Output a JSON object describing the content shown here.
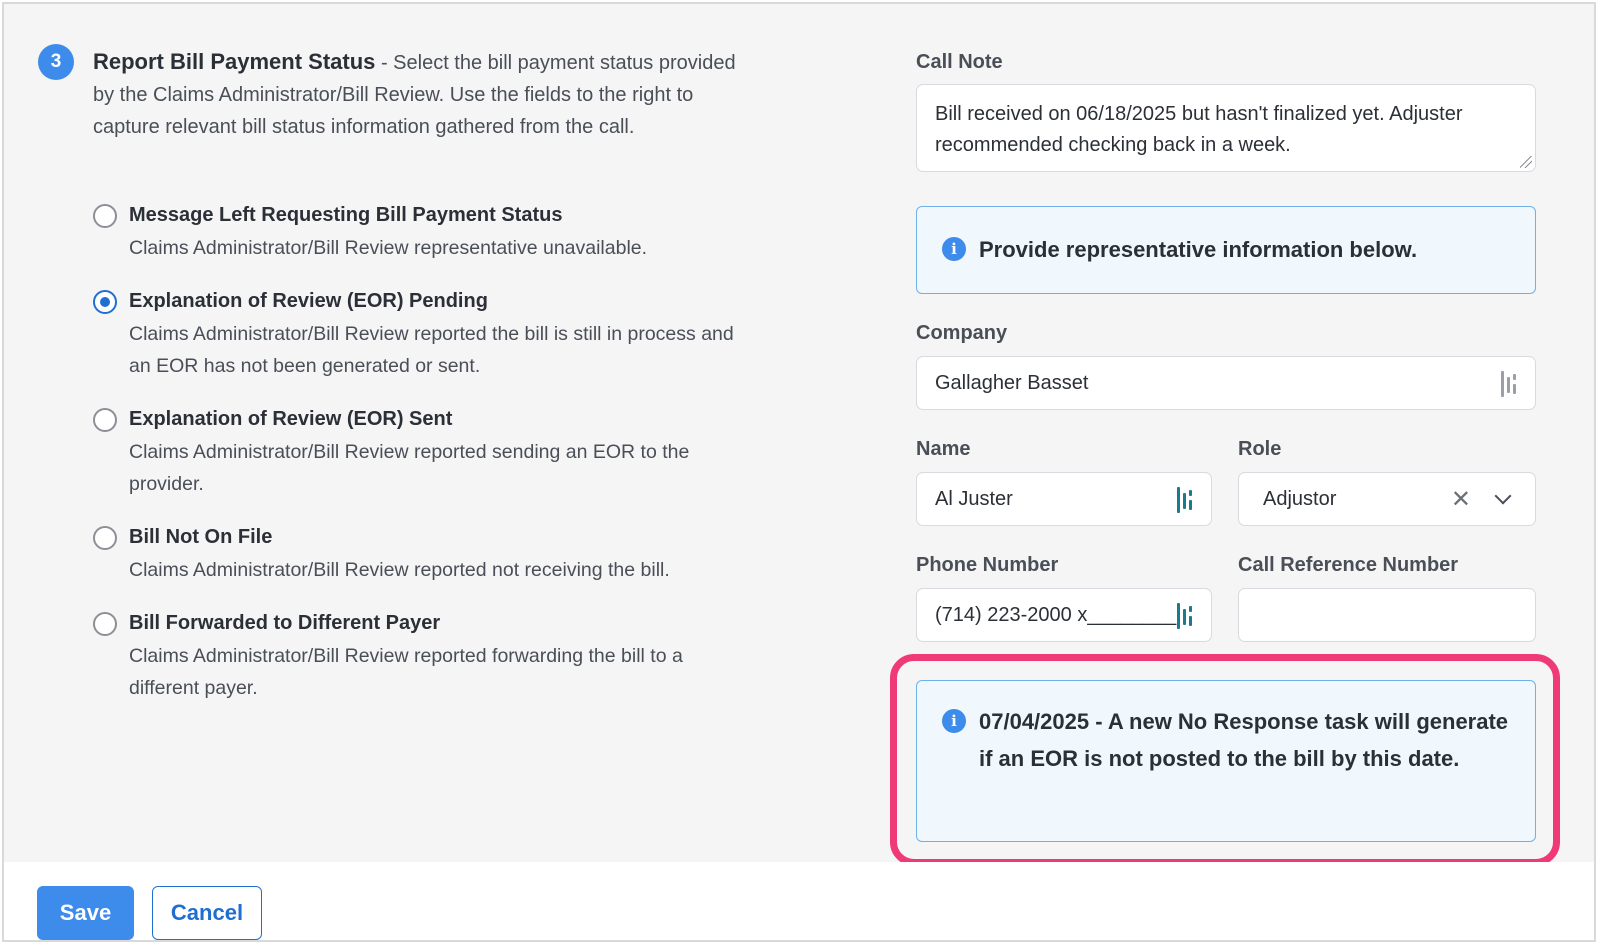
{
  "step": {
    "number": "3",
    "title": "Report Bill Payment Status",
    "description": " - Select the bill payment status provided by the Claims Administrator/Bill Review. Use the fields to the right to capture relevant bill status information gathered from the call."
  },
  "statuses": [
    {
      "label": "Message Left Requesting Bill Payment Status",
      "description": "Claims Administrator/Bill Review representative unavailable.",
      "checked": false
    },
    {
      "label": "Explanation of Review (EOR) Pending",
      "description": "Claims Administrator/Bill Review reported the bill is still in process and an EOR has not been generated or sent.",
      "checked": true
    },
    {
      "label": "Explanation of Review (EOR) Sent",
      "description": "Claims Administrator/Bill Review reported sending an EOR to the provider.",
      "checked": false
    },
    {
      "label": "Bill Not On File",
      "description": "Claims Administrator/Bill Review reported not receiving the bill.",
      "checked": false
    },
    {
      "label": "Bill Forwarded to Different Payer",
      "description": "Claims Administrator/Bill Review reported forwarding the bill to a different payer.",
      "checked": false
    }
  ],
  "call_note": {
    "label": "Call Note",
    "value": "Bill received on 06/18/2025 but hasn't finalized yet. Adjuster recommended checking back in a week."
  },
  "rep_info_notice": "Provide representative information below.",
  "company": {
    "label": "Company",
    "value": "Gallagher Basset"
  },
  "name": {
    "label": "Name",
    "value": "Al Juster"
  },
  "role": {
    "label": "Role",
    "value": "Adjustor"
  },
  "phone": {
    "label": "Phone Number",
    "value": "(714) 223-2000 x________"
  },
  "call_reference": {
    "label": "Call Reference Number",
    "value": ""
  },
  "followup_notice": "07/04/2025 - A new No Response task will generate if an EOR is not posted to the bill by this date.",
  "buttons": {
    "save": "Save",
    "cancel": "Cancel"
  },
  "colors": {
    "accent": "#3d8bea",
    "highlight": "#f03a78",
    "info_bg": "#f1f8fd"
  },
  "icons": {
    "info": "info-icon",
    "lastpass": "lastpass-icon",
    "clear": "clear-icon",
    "dropdown": "chevron-down-icon"
  }
}
